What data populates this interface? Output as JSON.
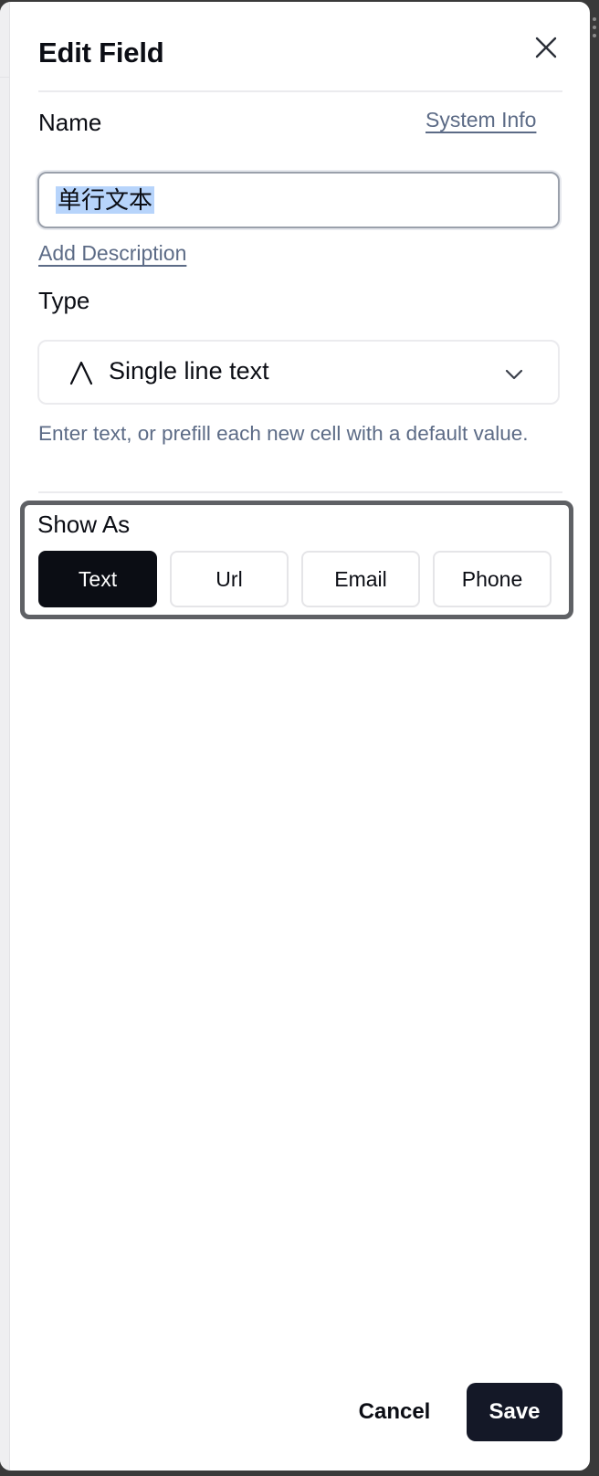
{
  "dialog": {
    "title": "Edit Field",
    "close_icon": "close-icon"
  },
  "name_section": {
    "label": "Name",
    "system_info_link": "System Info",
    "input_value": "单行文本",
    "add_description_link": "Add Description"
  },
  "type_section": {
    "label": "Type",
    "type_icon": "text-a-icon",
    "selected_value": "Single line text",
    "dropdown_icon": "chevron-down-icon",
    "helper_text": "Enter text, or prefill each new cell with a default value."
  },
  "show_as": {
    "label": "Show As",
    "selected": "Text",
    "options": [
      "Text",
      "Url",
      "Email",
      "Phone"
    ]
  },
  "footer": {
    "cancel_label": "Cancel",
    "save_label": "Save"
  },
  "colors": {
    "primary_dark": "#141827",
    "selected_segment": "#0b0d14",
    "link_muted": "#5c6b86",
    "text_selection": "#b7d4fb",
    "highlight_border": "#5f6165"
  }
}
